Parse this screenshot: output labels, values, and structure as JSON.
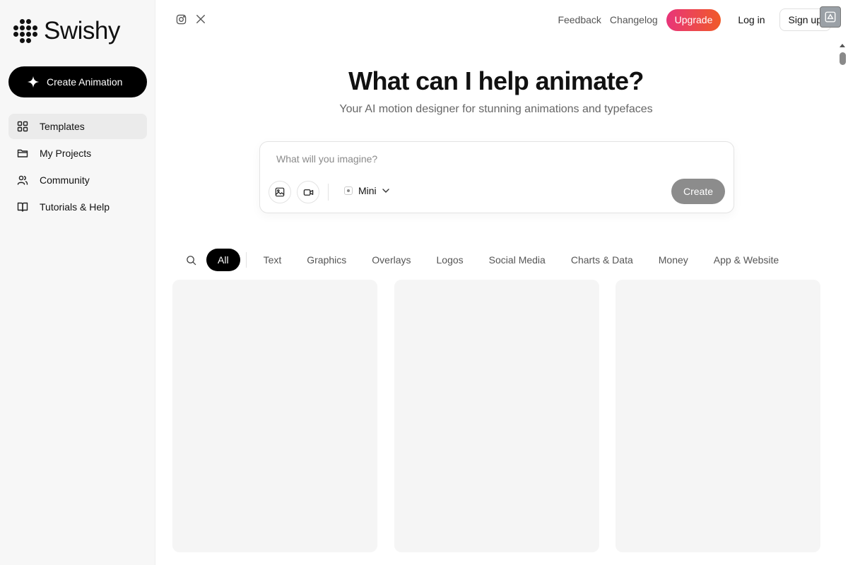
{
  "app": {
    "name": "Swishy"
  },
  "sidebar": {
    "create_label": "Create Animation",
    "items": [
      {
        "label": "Templates",
        "icon": "grid-icon"
      },
      {
        "label": "My Projects",
        "icon": "folder-icon"
      },
      {
        "label": "Community",
        "icon": "users-icon"
      },
      {
        "label": "Tutorials & Help",
        "icon": "book-icon"
      }
    ]
  },
  "header": {
    "social": [
      "instagram-icon",
      "x-icon"
    ],
    "feedback": "Feedback",
    "changelog": "Changelog",
    "upgrade": "Upgrade",
    "login": "Log in",
    "signup": "Sign up"
  },
  "hero": {
    "title": "What can I help animate?",
    "subtitle": "Your AI motion designer for stunning animations and typefaces"
  },
  "prompt": {
    "placeholder": "What will you imagine?",
    "model": "Mini",
    "submit": "Create"
  },
  "filters": {
    "items": [
      "All",
      "Text",
      "Graphics",
      "Overlays",
      "Logos",
      "Social Media",
      "Charts & Data",
      "Money",
      "App & Website"
    ],
    "selected": "All"
  },
  "colors": {
    "accent": "#000000",
    "upgrade_start": "#e8357a",
    "upgrade_end": "#f05a28",
    "sidebar_bg": "#f7f7f7"
  }
}
